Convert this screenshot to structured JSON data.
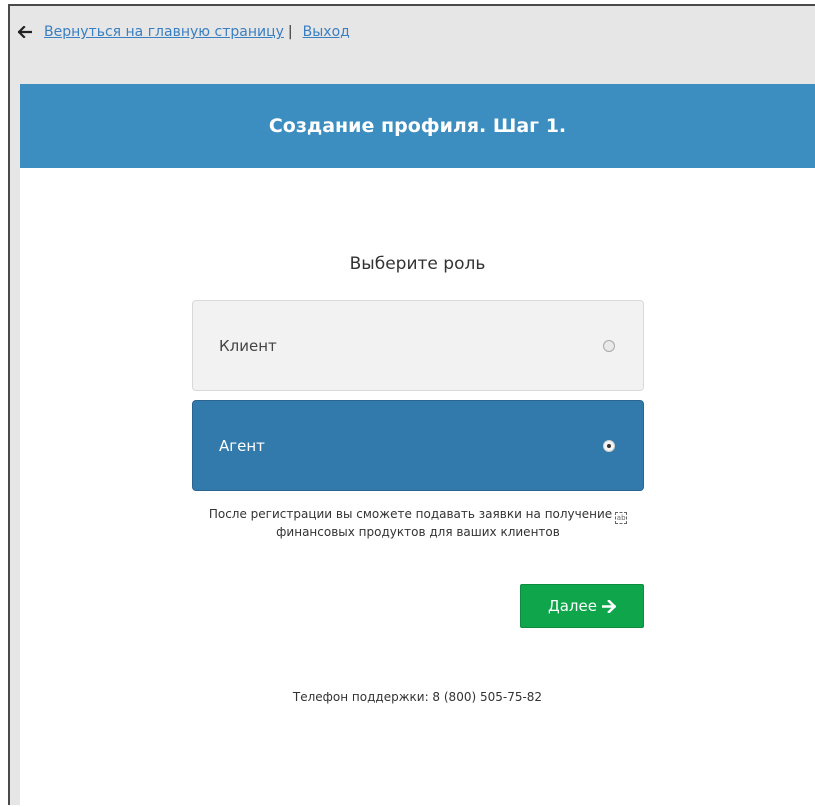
{
  "nav": {
    "back_label": "Вернуться на главную страницу",
    "separator": "|",
    "logout_label": "Выход"
  },
  "header": {
    "title": "Создание профиля. Шаг 1."
  },
  "role": {
    "prompt": "Выберите роль",
    "options": [
      {
        "label": "Клиент",
        "selected": false
      },
      {
        "label": "Агент",
        "selected": true
      }
    ],
    "description_line1": "После регистрации вы сможете подавать заявки на получение",
    "description_line2": "финансовых продуктов для ваших клиентов"
  },
  "actions": {
    "next_label": "Далее"
  },
  "footer": {
    "support_text": "Телефон поддержки: 8 (800) 505-75-82"
  },
  "colors": {
    "header_bg": "#3b8ebf",
    "selected_option_bg": "#327aab",
    "next_button_bg": "#0fa54a",
    "link": "#3a7fc1"
  },
  "icons": {
    "back": "arrow-left-icon",
    "next": "arrow-right-icon"
  }
}
